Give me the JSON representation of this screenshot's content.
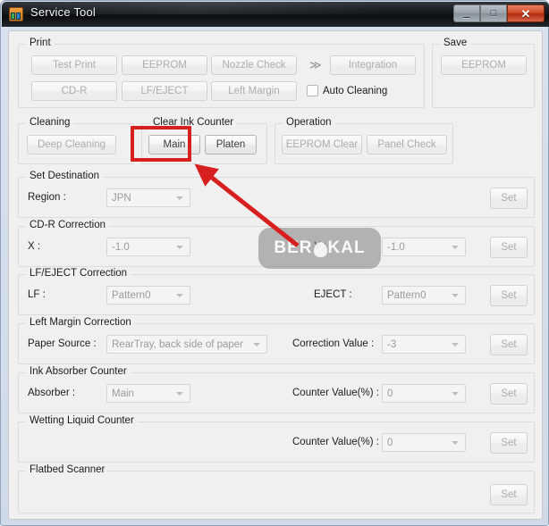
{
  "window": {
    "title": "Service Tool",
    "icon": "printer-icon",
    "controls": {
      "minimize": "–",
      "maximize": "□",
      "close": "✕"
    }
  },
  "groups": {
    "print": {
      "caption": "Print",
      "buttons": [
        {
          "label": "Test Print",
          "enabled": false
        },
        {
          "label": "EEPROM",
          "enabled": false
        },
        {
          "label": "Nozzle Check",
          "enabled": false
        },
        {
          "label": "Integration",
          "enabled": false
        },
        {
          "label": "CD-R",
          "enabled": false
        },
        {
          "label": "LF/EJECT",
          "enabled": false
        },
        {
          "label": "Left Margin",
          "enabled": false
        }
      ],
      "chevron": "≫",
      "auto_cleaning": {
        "label": "Auto Cleaning",
        "checked": false
      }
    },
    "save": {
      "caption": "Save",
      "button": {
        "label": "EEPROM",
        "enabled": false
      }
    },
    "cleaning": {
      "caption": "Cleaning",
      "button": {
        "label": "Deep Cleaning",
        "enabled": false
      }
    },
    "clear_ink_counter": {
      "caption": "Clear Ink Counter",
      "buttons": [
        {
          "label": "Main",
          "enabled": true,
          "highlighted": true
        },
        {
          "label": "Platen",
          "enabled": true
        }
      ]
    },
    "operation": {
      "caption": "Operation",
      "buttons": [
        {
          "label": "EEPROM Clear",
          "enabled": false
        },
        {
          "label": "Panel Check",
          "enabled": false
        }
      ]
    },
    "set_destination": {
      "caption": "Set Destination",
      "region_label": "Region :",
      "region_value": "JPN",
      "set_label": "Set"
    },
    "cdr_correction": {
      "caption": "CD-R Correction",
      "x_label": "X :",
      "x_value": "-1.0",
      "y_label": "Y :",
      "y_value": "-1.0",
      "set_label": "Set"
    },
    "lf_eject_correction": {
      "caption": "LF/EJECT Correction",
      "lf_label": "LF :",
      "lf_value": "Pattern0",
      "eject_label": "EJECT :",
      "eject_value": "Pattern0",
      "set_label": "Set"
    },
    "left_margin_correction": {
      "caption": "Left Margin Correction",
      "paper_source_label": "Paper Source :",
      "paper_source_value": "RearTray, back side of paper",
      "correction_value_label": "Correction Value :",
      "correction_value": "-3",
      "set_label": "Set"
    },
    "ink_absorber_counter": {
      "caption": "Ink Absorber Counter",
      "absorber_label": "Absorber :",
      "absorber_value": "Main",
      "counter_value_label": "Counter Value(%) :",
      "counter_value": "0",
      "set_label": "Set"
    },
    "wetting_liquid_counter": {
      "caption": "Wetting Liquid Counter",
      "counter_value_label": "Counter Value(%) :",
      "counter_value": "0",
      "set_label": "Set"
    },
    "flatbed_scanner": {
      "caption": "Flatbed Scanner",
      "set_label": "Set"
    }
  },
  "annotations": {
    "highlight_target": "Main",
    "highlight_color": "#d81f1f",
    "arrow_color": "#d81f1f"
  },
  "watermark": {
    "text_before": "BER",
    "text_after": "KAL",
    "logo": "owl-logo"
  }
}
